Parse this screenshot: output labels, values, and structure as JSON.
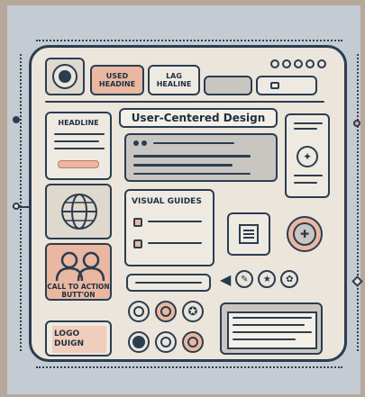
{
  "header": {
    "used_headline": "USED\nHEADINE",
    "lag_healine": "LAG\nHEALINE",
    "pagination_dots": 5
  },
  "sidebar": {
    "headline": "HEADLINE",
    "call_to_action": "CALL TO ACTION\nBUTT'ON",
    "logo_design": "LOGO\nDUIGN"
  },
  "main": {
    "title": "User-Centered Design",
    "visual_guides": "VISUAL GUIDES"
  },
  "colors": {
    "background": "#b7a89a",
    "frame": "#ebe5dc",
    "outline": "#2b3d50",
    "accent_salmon": "#eab7a0",
    "grey": "#c9c6c2"
  }
}
